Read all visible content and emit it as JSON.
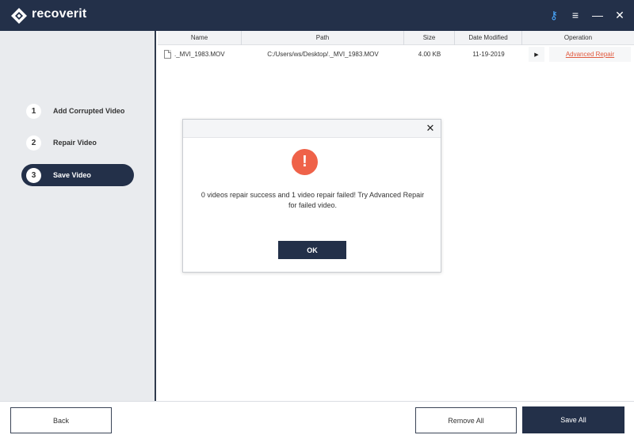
{
  "app": {
    "name": "recoverit",
    "brand_color": "#233049",
    "accent_color": "#ef6249"
  },
  "titlebar": {
    "icons": [
      "key-icon",
      "menu-icon",
      "minimize-icon",
      "close-icon"
    ],
    "key_glyph": "⚷",
    "menu_glyph": "≡",
    "minimize_glyph": "—",
    "close_glyph": "✕"
  },
  "steps": [
    {
      "num": "1",
      "label": "Add Corrupted Video",
      "active": false
    },
    {
      "num": "2",
      "label": "Repair Video",
      "active": false
    },
    {
      "num": "3",
      "label": "Save Video",
      "active": true
    }
  ],
  "table": {
    "columns": [
      "Name",
      "Path",
      "Size",
      "Date Modified",
      "Operation"
    ],
    "rows": [
      {
        "name": "._MVI_1983.MOV",
        "path": "C:/Users/ws/Desktop/._MVI_1983.MOV",
        "size": "4.00  KB",
        "date": "11-19-2019",
        "play": "▶",
        "operation": "Advanced Repair"
      }
    ]
  },
  "dialog": {
    "icon": "warning-icon",
    "warn_glyph": "!",
    "close_glyph": "✕",
    "message": "0 videos repair success and 1 video repair failed! Try Advanced Repair for failed video.",
    "ok_label": "OK"
  },
  "footer": {
    "back_label": "Back",
    "remove_all_label": "Remove All",
    "save_all_label": "Save All"
  }
}
